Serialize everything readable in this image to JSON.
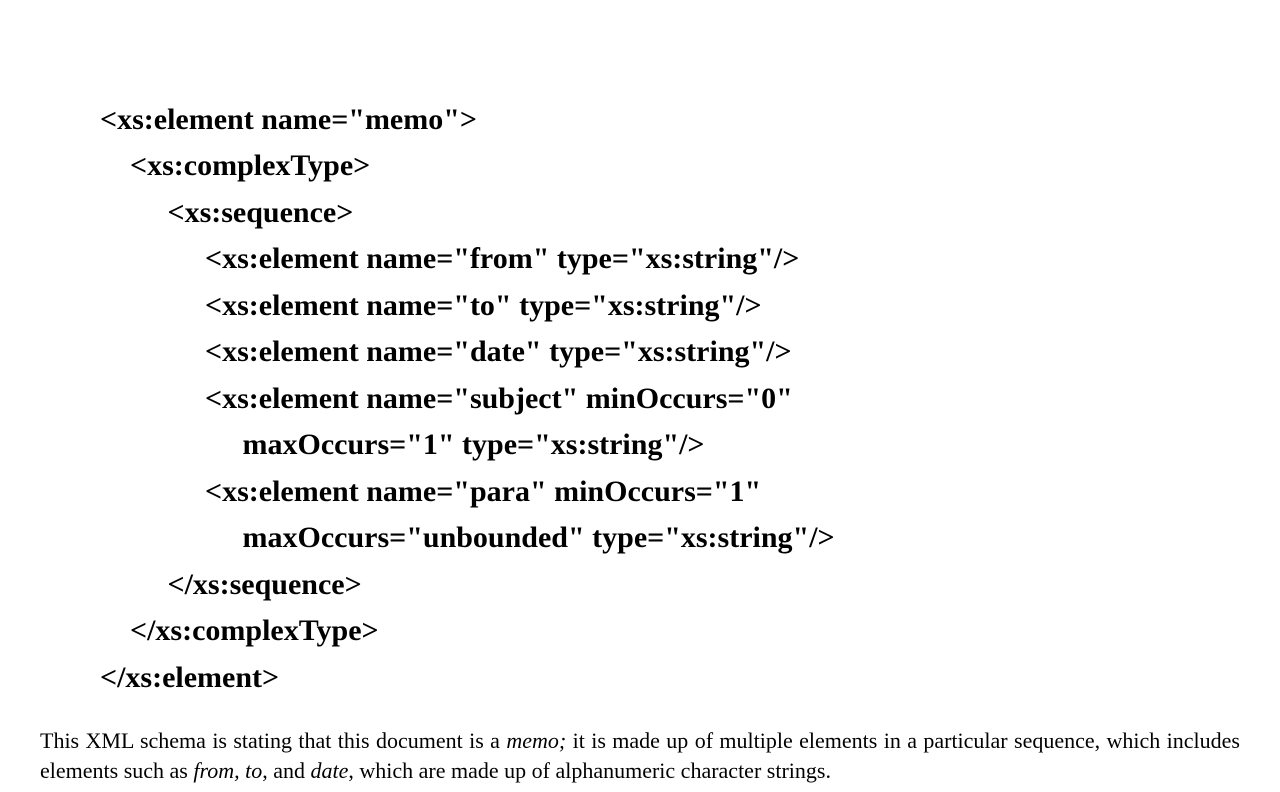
{
  "code": {
    "line1": "<xs:element name=\"memo\">",
    "line2": "    <xs:complexType>",
    "line3": "         <xs:sequence>",
    "line4": "              <xs:element name=\"from\" type=\"xs:string\"/>",
    "line5": "              <xs:element name=\"to\" type=\"xs:string\"/>",
    "line6": "              <xs:element name=\"date\" type=\"xs:string\"/>",
    "line7": "              <xs:element name=\"subject\" minOccurs=\"0\"",
    "line8": "                   maxOccurs=\"1\" type=\"xs:string\"/>",
    "line9": "              <xs:element name=\"para\" minOccurs=\"1\"",
    "line10": "                   maxOccurs=\"unbounded\" type=\"xs:string\"/>",
    "line11": "         </xs:sequence>",
    "line12": "    </xs:complexType>",
    "line13": "</xs:element>"
  },
  "paragraph": {
    "part1": "This XML schema is stating that this document is a ",
    "italic1": "memo;",
    "part2": " it is made up of multiple elements in a particular sequence, which includes elements such as ",
    "italic2": "from, to",
    "part3": ", and ",
    "italic3": "date",
    "part4": ", which are made up of alphanumeric character strings."
  }
}
